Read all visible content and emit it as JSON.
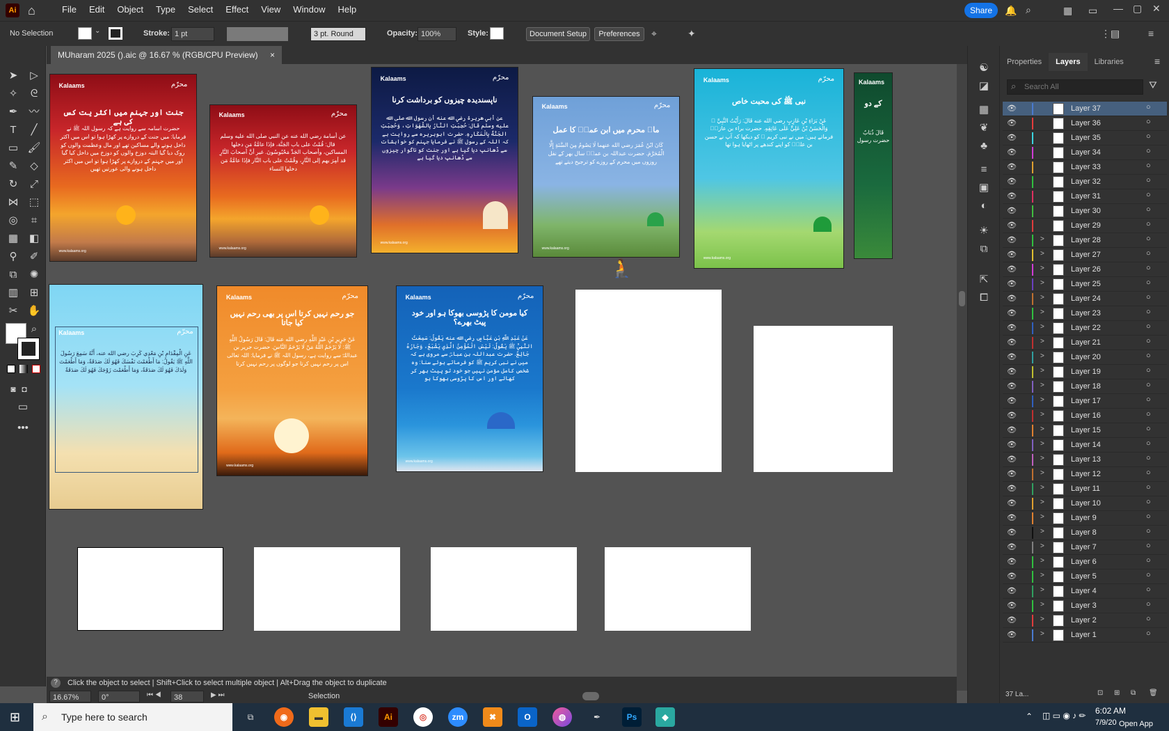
{
  "menubar": {
    "app_badge": "Ai",
    "items": [
      "File",
      "Edit",
      "Object",
      "Type",
      "Select",
      "Effect",
      "View",
      "Window",
      "Help"
    ],
    "share": "Share"
  },
  "control": {
    "selection": "No Selection",
    "stroke_label": "Stroke:",
    "stroke_value": "1 pt",
    "brush": "3 pt. Round",
    "opacity_label": "Opacity:",
    "opacity_value": "100%",
    "style_label": "Style:",
    "doc_setup": "Document Setup",
    "prefs": "Preferences"
  },
  "doc_tab": {
    "title": "MUharam 2025 ().aic @ 16.67 % (RGB/CPU Preview)",
    "close": "×"
  },
  "artboards": {
    "a1": {
      "brand": "Kalaams",
      "logo": "محرّم",
      "title": "جنت اور جہنم میں اکثر یت کس کی ہے",
      "body": "حضرت اسامہ سے روایت ہے کہ رسول اللہ ﷺ نے فرمایا: میں جنت کے دروازے پر کھڑا ہوا تو اس میں اکثر داخل ہونے والے مساکین تھے اور مال وعظمت والوں کو روک دیا گیا البتہ دوزخ والوں کو دوزخ میں داخل کیا گیا اور میں جہنم کے دروازے پر کھڑا ہوا تو اس میں اکثر داخل ہونے والی عورتیں تھیں",
      "url": "www.kalaams.org"
    },
    "a2": {
      "brand": "Kalaams",
      "logo": "محرّم",
      "body": "عن أسامة رضي الله عنه عن النبي صلى الله عليه وسلم قال: قُمْتُ على باب الجَنَّة، فإذَا عامَّةُ مَن دخلها المساكين، وأصحاب الجَدِّ مَحْبُوسُونَ. غير أنَّ أصحابَ النَّارِ قد أمِرَ بهم إلى النَّارِ، وقُمْتُ على باب النَّار فإذَا عامَّةُ مَن دخلها النساء",
      "url": "www.kalaams.org"
    },
    "a3": {
      "brand": "Kalaams",
      "logo": "محرّم",
      "title": "ناپسندیدہ چیزوں کو برداشت کرنا",
      "body": "عن أبي هريرة رضي الله عنه أن رسول الله صلى الله عليه وسلم قال: حُجِبَتِ النَّارُ بِالشَّهَوَاتِ، وَحُجِبَتِ الجَنَّةُ بِالْمَكَارِهِ. حضرت ابوہریرہ سے روایت ہے کہ اللہ کے رسول ﷺ نے فرمایا جہنم کو خواہشات سے ڈھانپ دیا گیا ہے اور جنت کو ناگوار چیزوں سے ڈھانپ دیا گیا ہے",
      "url": "www.kalaams.org"
    },
    "a4": {
      "brand": "Kalaams",
      "logo": "محرّم",
      "title": "ماہ محرم میں ابن عمرؓ کا عمل",
      "body": "كَانَ ابْنُ عُمَرَ رضي الله عنهما لَا يَصُومُ مِنَ السَّنَةِ إِلَّا الْمُحَرَّمَ. حضرت عبداللہ بن عمرؓ سال بھر کے نفل روزوں میں محرم کے روزے کو ترجیح دیتے تھے",
      "url": "www.kalaams.org"
    },
    "a5": {
      "brand": "Kalaams",
      "logo": "محرّم",
      "title": "نبی ﷺ کی محبت خاص",
      "body": "عَنْ بَرَاءِ بْنِ عَازِبٍ رضي الله عنه قَالَ: رَأَيْتُ النَّبِيَّ ﷺ وَالْحَسَنُ بْنُ عَلِيٍّ عَلَى عَاتِقِهِ. حضرت براء بن عازبؓ فرماتے ہیں: میں نے نبی کریم ﷺ کو دیکھا کہ آپ نے حسن بن علیؓ کو اپنے کندھے پر اٹھایا ہوا تھا",
      "url": "www.kalaams.org"
    },
    "a6": {
      "brand": "Kalaams",
      "logo": "محرّم",
      "title": "کے دو",
      "body": "قَالَ ذُبَابٌ حضرت رسول"
    },
    "a7": {
      "brand": "Kalaams",
      "logo": "محرّم",
      "body": "عَنِ الْمِقْدَامِ بْنِ مَعْدِي كَرِبَ رضي الله عنه، أَنَّهُ سَمِعَ رَسُولَ اللَّهِ ﷺ يَقُولُ: مَا أَطْعَمْتَ نَفْسَكَ فَهُوَ لَكَ صَدَقَةٌ، وَمَا أَطْعَمْتَ وَلَدَكَ فَهُوَ لَكَ صَدَقَةٌ، وَمَا أَطْعَمْتَ زَوْجَكَ فَهُوَ لَكَ صَدَقَةٌ"
    },
    "a8": {
      "brand": "Kalaams",
      "logo": "محرّم",
      "title": "جو رحم نہیں کرتا اس پر بھی رحم نہیں کیا جاتا",
      "body": "عَنْ جَرِيرِ بْنِ عَبْدِ اللَّهِ رضي الله عنه قَالَ: قَالَ رَسُولُ اللَّهِ ﷺ: لَا يَرْحَمُ اللَّهُ مَنْ لَا يَرْحَمُ النَّاسَ. حضرت جریر بن عبداللہؓ سے روایت ہے، رسول اللہ ﷺ نے فرمایا: اللہ تعالی اس پر رحم نہیں کرتا جو لوگوں پر رحم نہیں کرتا",
      "url": "www.kalaams.org"
    },
    "a9": {
      "brand": "Kalaams",
      "logo": "محرّم",
      "title": "کیا مومن کا پڑوسی بھوکا ہو اور خود پیٹ بھرے؟",
      "body": "عَنْ عَبْدِ اللَّهِ بْنِ عَبَّاسٍ رضي الله عنه يَقُولُ: سَمِعْتُ النَّبِيَّ ﷺ يَقُولُ: لَيْسَ الْمُؤْمِنُ الَّذِي يَشْبَعُ، وَجَارُهُ جَائِعٌ. حضرت عبداللہ بن عباسؓ سے مروی ہے کہ میں نے نبی کریم ﷺ کو فرماتے ہوئے سنا: وہ شخص کامل مؤمن نہیں جو خود تو پیٹ بھر کر کھائے اور اس کا پڑوسی بھوکا ہو",
      "url": "www.kalaams.org"
    }
  },
  "status": {
    "hint": "Click the object to select  |  Shift+Click to select multiple object  |  Alt+Drag the object to duplicate",
    "zoom": "16.67%",
    "angle": "0°",
    "artboard_num": "38",
    "tool": "Selection"
  },
  "panel": {
    "tabs": [
      "Properties",
      "Layers",
      "Libraries"
    ],
    "search_placeholder": "Search All",
    "count": "37 La..."
  },
  "layers": [
    {
      "name": "Layer 37",
      "color": "#4a7bd0",
      "sel": true,
      "arrow": ""
    },
    {
      "name": "Layer 36",
      "color": "#e63c3c",
      "arrow": ""
    },
    {
      "name": "Layer 35",
      "color": "#3ad6e0",
      "arrow": ""
    },
    {
      "name": "Layer 34",
      "color": "#d03cd6",
      "arrow": ""
    },
    {
      "name": "Layer 33",
      "color": "#e0a030",
      "arrow": ""
    },
    {
      "name": "Layer 32",
      "color": "#30c040",
      "arrow": ""
    },
    {
      "name": "Layer 31",
      "color": "#e03060",
      "arrow": ""
    },
    {
      "name": "Layer 30",
      "color": "#40c040",
      "arrow": ""
    },
    {
      "name": "Layer 29",
      "color": "#e03c3c",
      "arrow": ""
    },
    {
      "name": "Layer 28",
      "color": "#30c040",
      "arrow": ">"
    },
    {
      "name": "Layer 27",
      "color": "#e0c030",
      "arrow": ">"
    },
    {
      "name": "Layer 26",
      "color": "#d03cd6",
      "arrow": ">"
    },
    {
      "name": "Layer 25",
      "color": "#6a40c0",
      "arrow": ">"
    },
    {
      "name": "Layer 24",
      "color": "#c07030",
      "arrow": ">"
    },
    {
      "name": "Layer 23",
      "color": "#30c040",
      "arrow": ">"
    },
    {
      "name": "Layer 22",
      "color": "#3060c0",
      "arrow": ">"
    },
    {
      "name": "Layer 21",
      "color": "#c03030",
      "arrow": ">"
    },
    {
      "name": "Layer 20",
      "color": "#30a0a0",
      "arrow": ">"
    },
    {
      "name": "Layer 19",
      "color": "#c0c030",
      "arrow": ">"
    },
    {
      "name": "Layer 18",
      "color": "#8060c0",
      "arrow": ">"
    },
    {
      "name": "Layer 17",
      "color": "#3060c0",
      "arrow": ">"
    },
    {
      "name": "Layer 16",
      "color": "#c03030",
      "arrow": ">"
    },
    {
      "name": "Layer 15",
      "color": "#e08030",
      "arrow": ">"
    },
    {
      "name": "Layer 14",
      "color": "#8060c0",
      "arrow": ">"
    },
    {
      "name": "Layer 13",
      "color": "#c060c0",
      "arrow": ">"
    },
    {
      "name": "Layer 12",
      "color": "#c07030",
      "arrow": ">"
    },
    {
      "name": "Layer 11",
      "color": "#30a060",
      "arrow": ">"
    },
    {
      "name": "Layer 10",
      "color": "#e0a030",
      "arrow": ">"
    },
    {
      "name": "Layer 9",
      "color": "#e08030",
      "arrow": ">"
    },
    {
      "name": "Layer 8",
      "color": "#111111",
      "arrow": ">"
    },
    {
      "name": "Layer 7",
      "color": "#808080",
      "arrow": ">"
    },
    {
      "name": "Layer 6",
      "color": "#30c040",
      "arrow": ">"
    },
    {
      "name": "Layer 5",
      "color": "#30c040",
      "arrow": ">"
    },
    {
      "name": "Layer 4",
      "color": "#30a060",
      "arrow": ">"
    },
    {
      "name": "Layer 3",
      "color": "#30c040",
      "arrow": ">"
    },
    {
      "name": "Layer 2",
      "color": "#e03c3c",
      "arrow": ">"
    },
    {
      "name": "Layer 1",
      "color": "#4a7bd0",
      "arrow": ">"
    }
  ],
  "taskbar": {
    "search": "Type here to search",
    "time": "6:02 AM",
    "date": "7/9/20",
    "openapp": "Open App",
    "ai": "Ai",
    "ps": "Ps",
    "zm": "zm"
  }
}
